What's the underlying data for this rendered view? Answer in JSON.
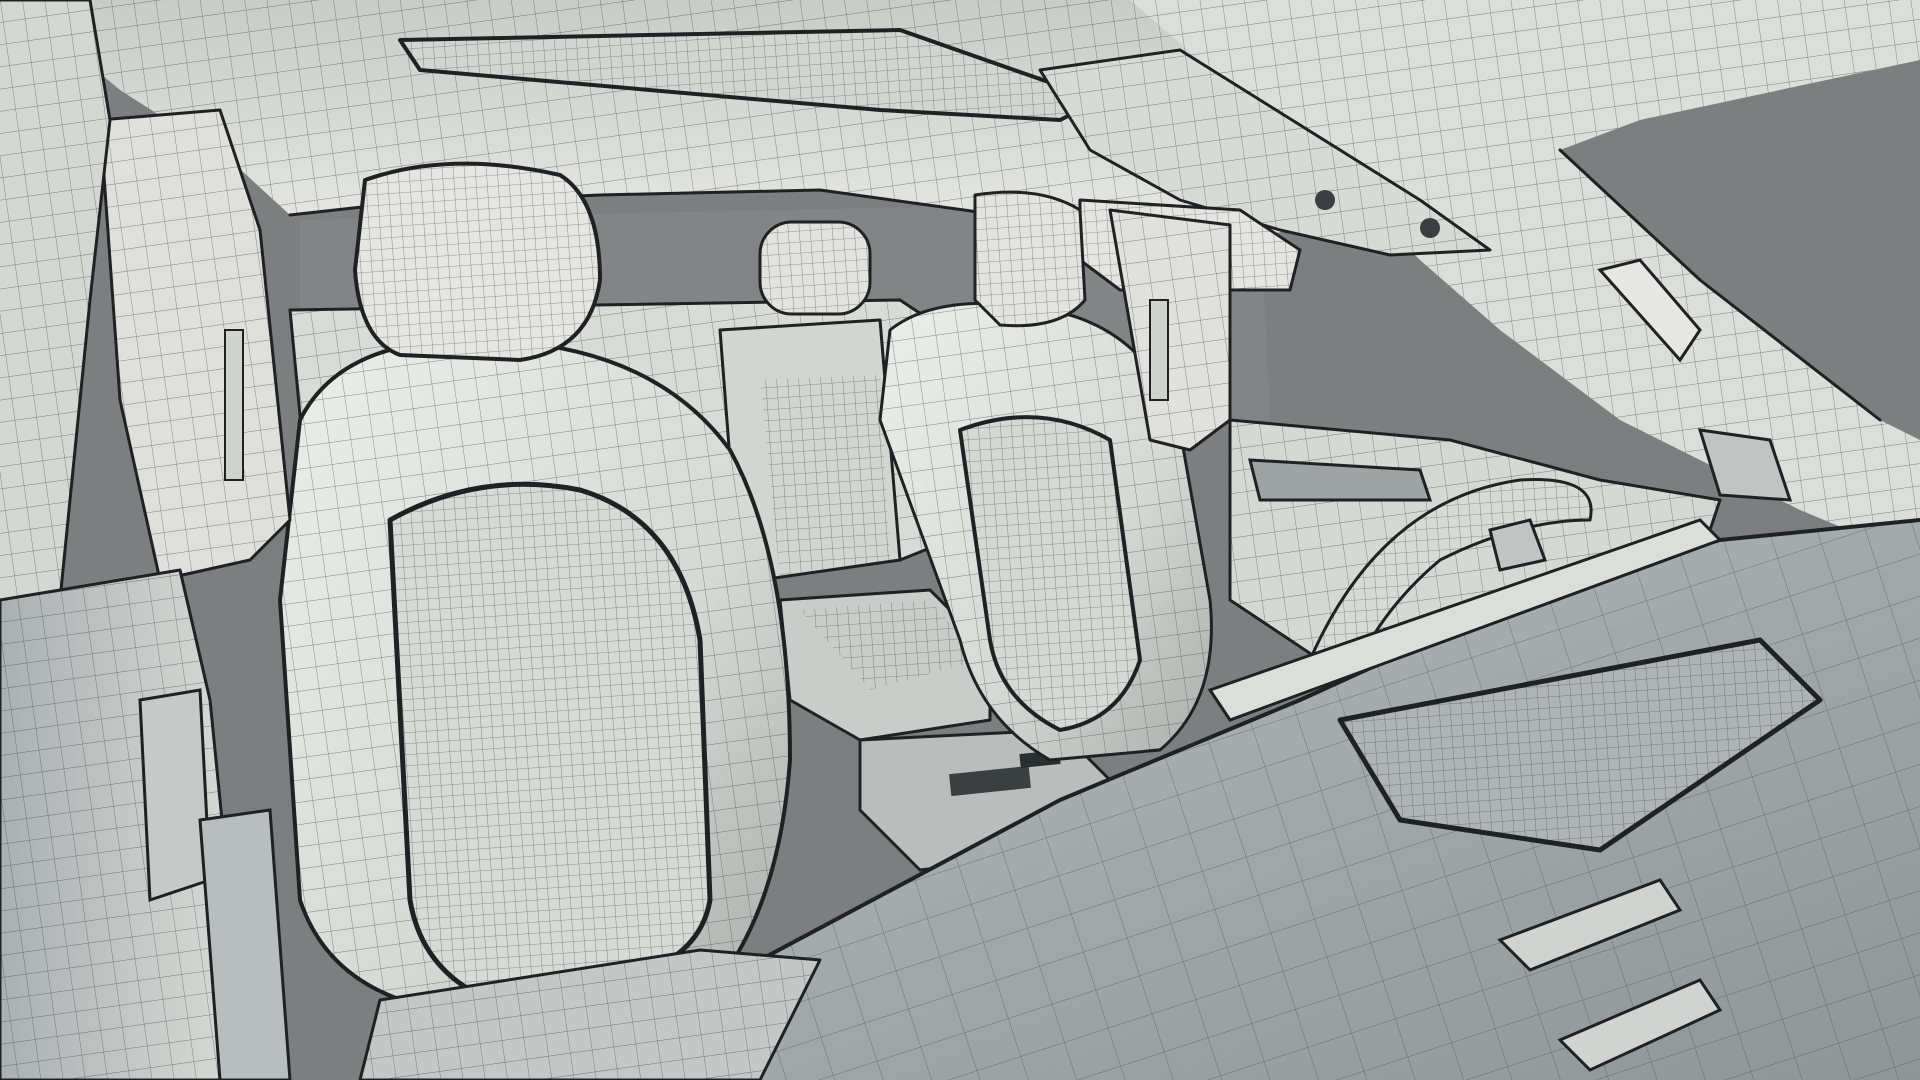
{
  "scene": {
    "subject": "car-interior-wireframe-render",
    "colors": {
      "background": "#7c7e7f",
      "surface_light": "#e4e5e0",
      "surface_mid": "#c9ccc8",
      "surface_shadow": "#9ea3a4",
      "dashboard": "#a7adb0",
      "wire": "#1e2224"
    }
  }
}
